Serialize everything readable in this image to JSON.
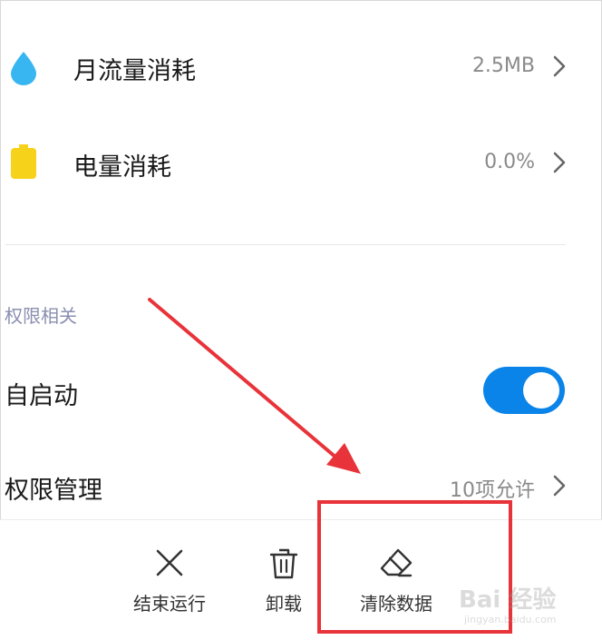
{
  "stats": [
    {
      "label": "月流量消耗",
      "value": "2.5MB",
      "icon": "water-drop-icon"
    },
    {
      "label": "电量消耗",
      "value": "0.0%",
      "icon": "battery-icon"
    }
  ],
  "permissions": {
    "section_title": "权限相关",
    "autostart": {
      "label": "自启动",
      "enabled": true
    },
    "manage": {
      "label": "权限管理",
      "value": "10项允许"
    }
  },
  "actions": [
    {
      "label": "结束运行",
      "icon": "close-icon"
    },
    {
      "label": "卸载",
      "icon": "trash-icon"
    },
    {
      "label": "清除数据",
      "icon": "eraser-icon"
    }
  ],
  "watermark": {
    "main": "Bai 经验",
    "sub": "jingyan.baidu.com"
  },
  "colors": {
    "accent": "#0a84e8",
    "drop": "#38b6f1",
    "battery": "#f7d21a",
    "annotation": "#e8333a"
  }
}
